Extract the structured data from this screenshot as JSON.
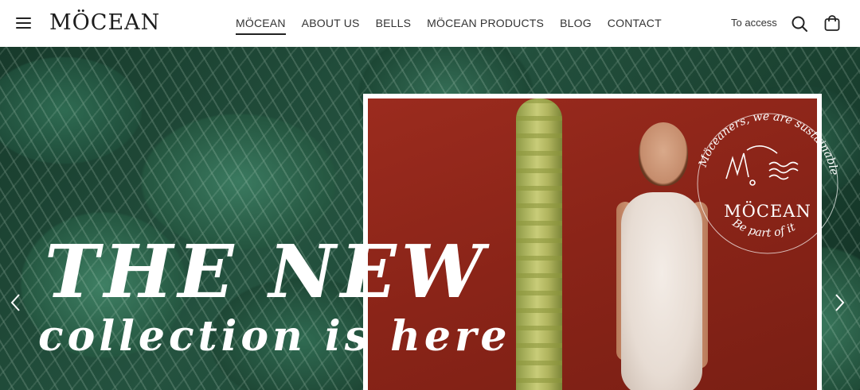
{
  "header": {
    "logo_text": "MÖCEAN",
    "nav": [
      {
        "label": "MÖCEAN",
        "active": true
      },
      {
        "label": "ABOUT US",
        "active": false
      },
      {
        "label": "BELLS",
        "active": false
      },
      {
        "label": "MÖCEAN PRODUCTS",
        "active": false
      },
      {
        "label": "BLOG",
        "active": false
      },
      {
        "label": "CONTACT",
        "active": false
      }
    ],
    "access_label": "To access",
    "icons": [
      "menu-icon",
      "search-icon",
      "cart-icon"
    ]
  },
  "hero": {
    "headline": "THE NEW",
    "subline": "collection is here",
    "badge": {
      "top_arc": "Möceaners, we are sustainable",
      "brand": "MÖCEAN",
      "bottom_arc": "Be part of it"
    },
    "arrows": [
      "chevron-left-icon",
      "chevron-right-icon"
    ]
  }
}
